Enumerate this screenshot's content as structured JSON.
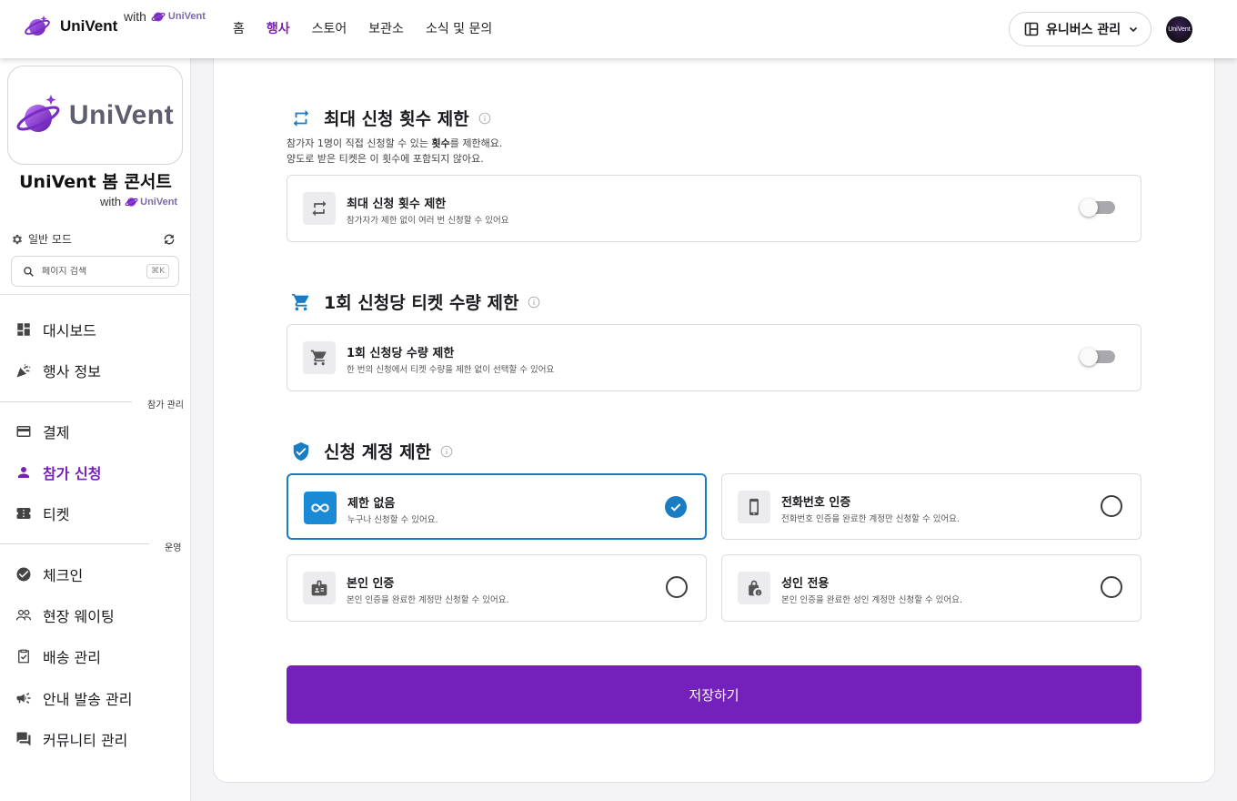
{
  "brand": {
    "name": "UniVent",
    "with": "with",
    "with_brand": "UniVent"
  },
  "nav": {
    "items": [
      "홈",
      "행사",
      "스토어",
      "보관소",
      "소식 및 문의"
    ],
    "active": "행사"
  },
  "universe_button": {
    "label": "유니버스 관리"
  },
  "avatar": {
    "text": "UniVent"
  },
  "sidebar": {
    "logo_text": "UniVent",
    "event_title": "UniVent 봄 콘서트",
    "event_with": "with",
    "event_with_brand": "UniVent",
    "mode_label": "일반 모드",
    "search_placeholder": "페이지 검색",
    "search_shortcut": "⌘K",
    "menu": {
      "dashboard": "대시보드",
      "event_info": "행사 정보",
      "section_participation": "참가 관리",
      "payment": "결제",
      "application": "참가 신청",
      "ticket": "티켓",
      "section_operation": "운영",
      "checkin": "체크인",
      "waiting": "현장 웨이팅",
      "delivery": "배송 관리",
      "notice": "안내 발송 관리",
      "community": "커뮤니티 관리"
    }
  },
  "section_max": {
    "title": "최대 신청 횟수 제한",
    "desc_line1_prefix": "참가자 1명이 직접 신청할 수 있는 ",
    "desc_line1_bold": "횟수",
    "desc_line1_suffix": "를 제한해요.",
    "desc_line2": "양도로 받은 티켓은 이 횟수에 포함되지 않아요.",
    "option_title": "최대 신청 횟수 제한",
    "option_sub": "참가자가 제한 없이 여러 번 신청할 수 있어요",
    "enabled": false
  },
  "section_qty": {
    "title": "1회 신청당 티켓 수량 제한",
    "option_title": "1회 신청당 수량 제한",
    "option_sub": "한 번의 신청에서 티켓 수량을 제한 없이 선택할 수 있어요",
    "enabled": false
  },
  "section_account": {
    "title": "신청 계정 제한",
    "options": [
      {
        "title": "제한 없음",
        "sub": "누구나 신청할 수 있어요.",
        "icon": "infinity-icon",
        "selected": true
      },
      {
        "title": "전화번호 인증",
        "sub": "전화번호 인증을 완료한 계정만 신청할 수 있어요.",
        "icon": "phone-icon",
        "selected": false
      },
      {
        "title": "본인 인증",
        "sub": "본인 인증을 완료한 계정만 신청할 수 있어요.",
        "icon": "id-badge-icon",
        "selected": false
      },
      {
        "title": "성인 전용",
        "sub": "본인 인증을 완료한 성인 계정만 신청할 수 있어요.",
        "icon": "lock-info-icon",
        "selected": false
      }
    ]
  },
  "save_button": "저장하기",
  "colors": {
    "accent": "#7420ba",
    "selected_blue": "#1a7dc4",
    "nav_active": "#7a1fb8"
  }
}
